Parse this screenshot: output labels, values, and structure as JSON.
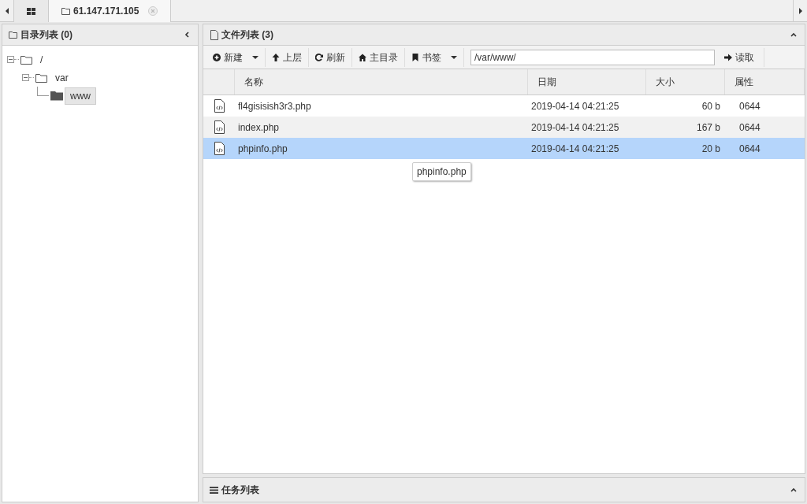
{
  "tabs": [
    {
      "kind": "home",
      "selected": false
    },
    {
      "kind": "host",
      "label": "61.147.171.105",
      "selected": true
    }
  ],
  "dir_panel": {
    "title": "目录列表 (0)",
    "tree": [
      {
        "label": "/",
        "expanded": true,
        "selected": false,
        "children": [
          {
            "label": "var",
            "expanded": true,
            "selected": false,
            "children": [
              {
                "label": "www",
                "selected": true
              }
            ]
          }
        ]
      }
    ]
  },
  "file_panel": {
    "title": "文件列表 (3)",
    "toolbar": [
      {
        "kind": "plus",
        "label": "新建",
        "dropdown": true
      },
      {
        "kind": "up",
        "label": "上层",
        "dropdown": false
      },
      {
        "kind": "refresh",
        "label": "刷新",
        "dropdown": false
      },
      {
        "kind": "home",
        "label": "主目录",
        "dropdown": false
      },
      {
        "kind": "bookmark",
        "label": "书签",
        "dropdown": true
      }
    ],
    "path": "/var/www/",
    "read_button": "读取",
    "columns": [
      "名称",
      "日期",
      "大小",
      "属性"
    ],
    "rows": [
      {
        "name": "fl4gisisish3r3.php",
        "date": "2019-04-14 04:21:25",
        "size": "60 b",
        "perm": "0644",
        "selected": false
      },
      {
        "name": "index.php",
        "date": "2019-04-14 04:21:25",
        "size": "167 b",
        "perm": "0644",
        "selected": false
      },
      {
        "name": "phpinfo.php",
        "date": "2019-04-14 04:21:25",
        "size": "20 b",
        "perm": "0644",
        "selected": true
      }
    ],
    "tooltip": "phpinfo.php"
  },
  "task_panel": {
    "title": "任务列表"
  }
}
